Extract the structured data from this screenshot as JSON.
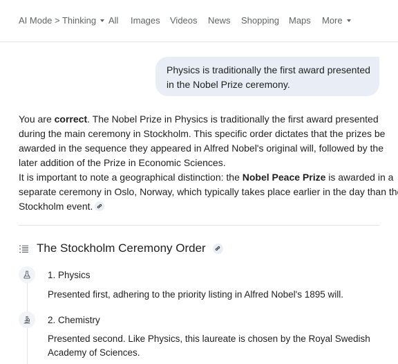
{
  "nav": {
    "items": [
      {
        "label": "AI Mode > Thinking",
        "dropdown": true
      },
      {
        "label": "All"
      },
      {
        "label": "Images"
      },
      {
        "label": "Videos"
      },
      {
        "label": "News"
      },
      {
        "label": "Shopping"
      },
      {
        "label": "Maps"
      },
      {
        "label": "More",
        "dropdown": true
      }
    ]
  },
  "user_message": {
    "lines": [
      "Physics is traditionally the first award presented",
      "in the Nobel Prize ceremony."
    ]
  },
  "answer": {
    "para1": {
      "lead": "You are ",
      "bold": "correct",
      "line1_rest": ". The Nobel Prize in Physics is traditionally the first award presented",
      "line2": "during the main ceremony in Stockholm. This specific order dictates that the prizes be",
      "line3": "awarded in the sequence they appeared in Alfred Nobel's original will, followed by the",
      "line4": "later addition of the Prize in Economic Sciences."
    },
    "para2": {
      "lead": "It is important to note a geographical distinction: the ",
      "bold": "Nobel Peace Prize",
      "line1_rest": " is awarded in a",
      "line2": "separate ceremony in Oslo, Norway, which typically takes place earlier in the day than the",
      "line3": "Stockholm event."
    }
  },
  "section": {
    "title": "The Stockholm Ceremony Order",
    "icon": "list-numbered-icon"
  },
  "steps": [
    {
      "icon": "flask-icon",
      "heading": "1. Physics",
      "body": [
        "Presented first, adhering to the priority listing in Alfred Nobel's 1895 will."
      ]
    },
    {
      "icon": "microscope-icon",
      "heading": "2. Chemistry",
      "body": [
        "Presented second. Like Physics, this laureate is chosen by the Royal Swedish",
        "Academy of Sciences."
      ]
    }
  ],
  "colors": {
    "bubble_bg": "#e9eef6",
    "text": "#1f1f1f",
    "muted": "#5f6368",
    "divider": "#e3e3e3"
  }
}
